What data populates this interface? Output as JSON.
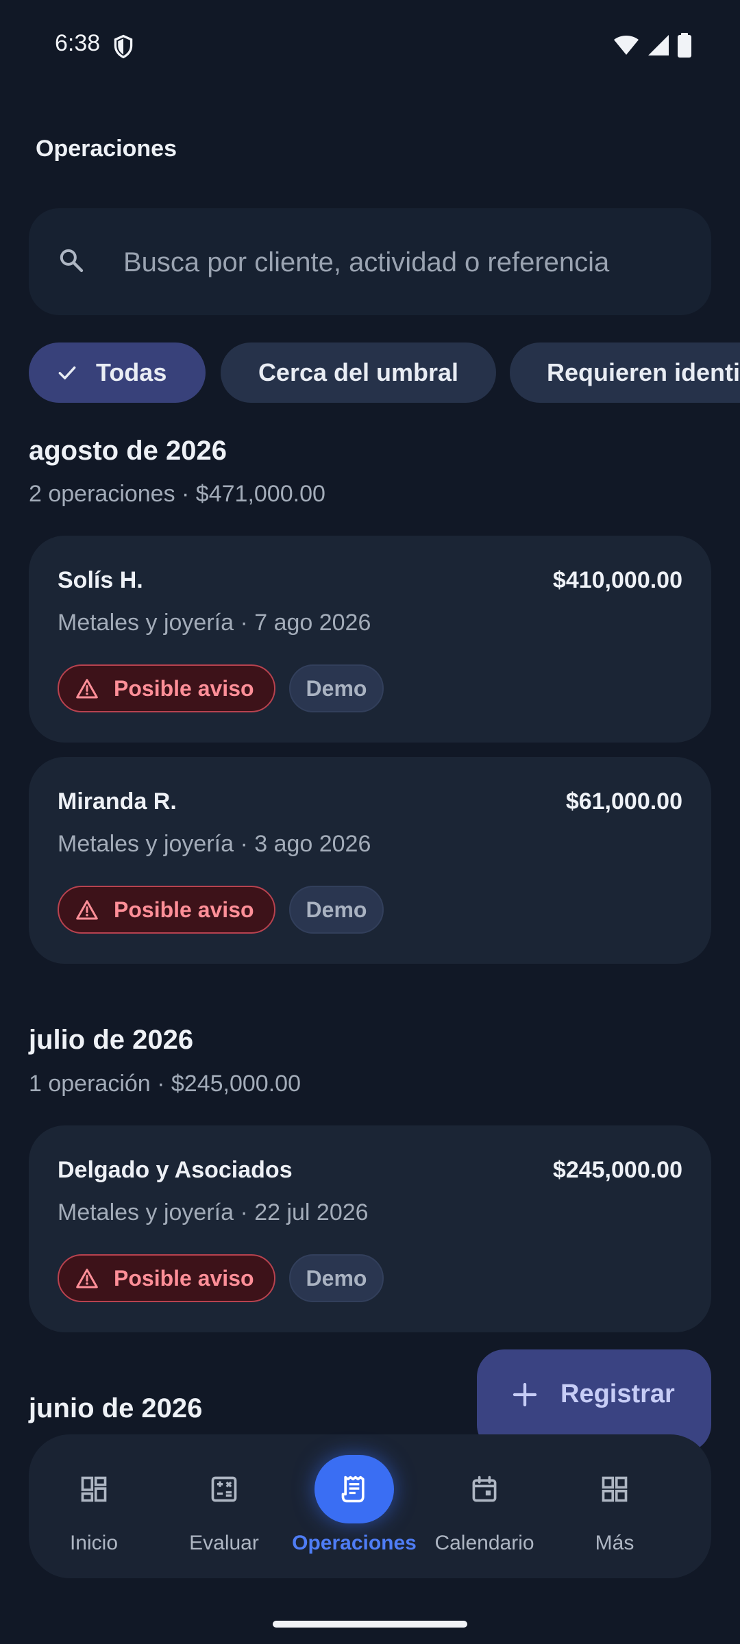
{
  "status_bar": {
    "time": "6:38"
  },
  "header": {
    "title": "Operaciones"
  },
  "search": {
    "placeholder": "Busca por cliente, actividad o referencia"
  },
  "filters": [
    {
      "label": "Todas",
      "selected": true
    },
    {
      "label": "Cerca del umbral",
      "selected": false
    },
    {
      "label": "Requieren identi",
      "selected": false
    }
  ],
  "groups": [
    {
      "title": "agosto de 2026",
      "summary": "2 operaciones · $471,000.00",
      "items": [
        {
          "name": "Solís H.",
          "amount": "$410,000.00",
          "meta": "Metales y joyería · 7 ago 2026",
          "alert": "Posible aviso",
          "tag": "Demo"
        },
        {
          "name": "Miranda R.",
          "amount": "$61,000.00",
          "meta": "Metales y joyería · 3 ago 2026",
          "alert": "Posible aviso",
          "tag": "Demo"
        }
      ]
    },
    {
      "title": "julio de 2026",
      "summary": "1 operación · $245,000.00",
      "items": [
        {
          "name": "Delgado y Asociados",
          "amount": "$245,000.00",
          "meta": "Metales y joyería · 22 jul 2026",
          "alert": "Posible aviso",
          "tag": "Demo"
        }
      ]
    },
    {
      "title": "junio de 2026"
    }
  ],
  "fab": {
    "label": "Registrar"
  },
  "nav": [
    {
      "label": "Inicio",
      "icon": "dashboard-icon"
    },
    {
      "label": "Evaluar",
      "icon": "calculator-icon"
    },
    {
      "label": "Operaciones",
      "icon": "receipt-icon",
      "active": true
    },
    {
      "label": "Calendario",
      "icon": "calendar-icon"
    },
    {
      "label": "Más",
      "icon": "apps-grid-icon"
    }
  ],
  "colors": {
    "background": "#111826",
    "accent": "#3a6ef3",
    "alert": "#ff8f98",
    "chip_selected": "#38417a"
  }
}
